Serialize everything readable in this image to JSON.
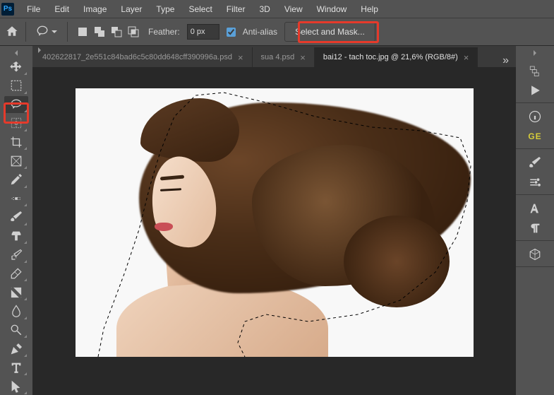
{
  "app": {
    "name": "Ps"
  },
  "menu": [
    "File",
    "Edit",
    "Image",
    "Layer",
    "Type",
    "Select",
    "Filter",
    "3D",
    "View",
    "Window",
    "Help"
  ],
  "options": {
    "feather_label": "Feather:",
    "feather_value": "0 px",
    "anti_alias_label": "Anti-alias",
    "select_mask_label": "Select and Mask..."
  },
  "tabs": [
    {
      "label": "402622817_2e551c84bad6c5c80dd648cff390996a.psd",
      "active": false
    },
    {
      "label": "sua 4.psd",
      "active": false
    },
    {
      "label": "bai12 - tach toc.jpg @ 21,6% (RGB/8#)",
      "active": true
    }
  ],
  "tab_overflow": "»",
  "right": {
    "ge_label": "GE"
  }
}
